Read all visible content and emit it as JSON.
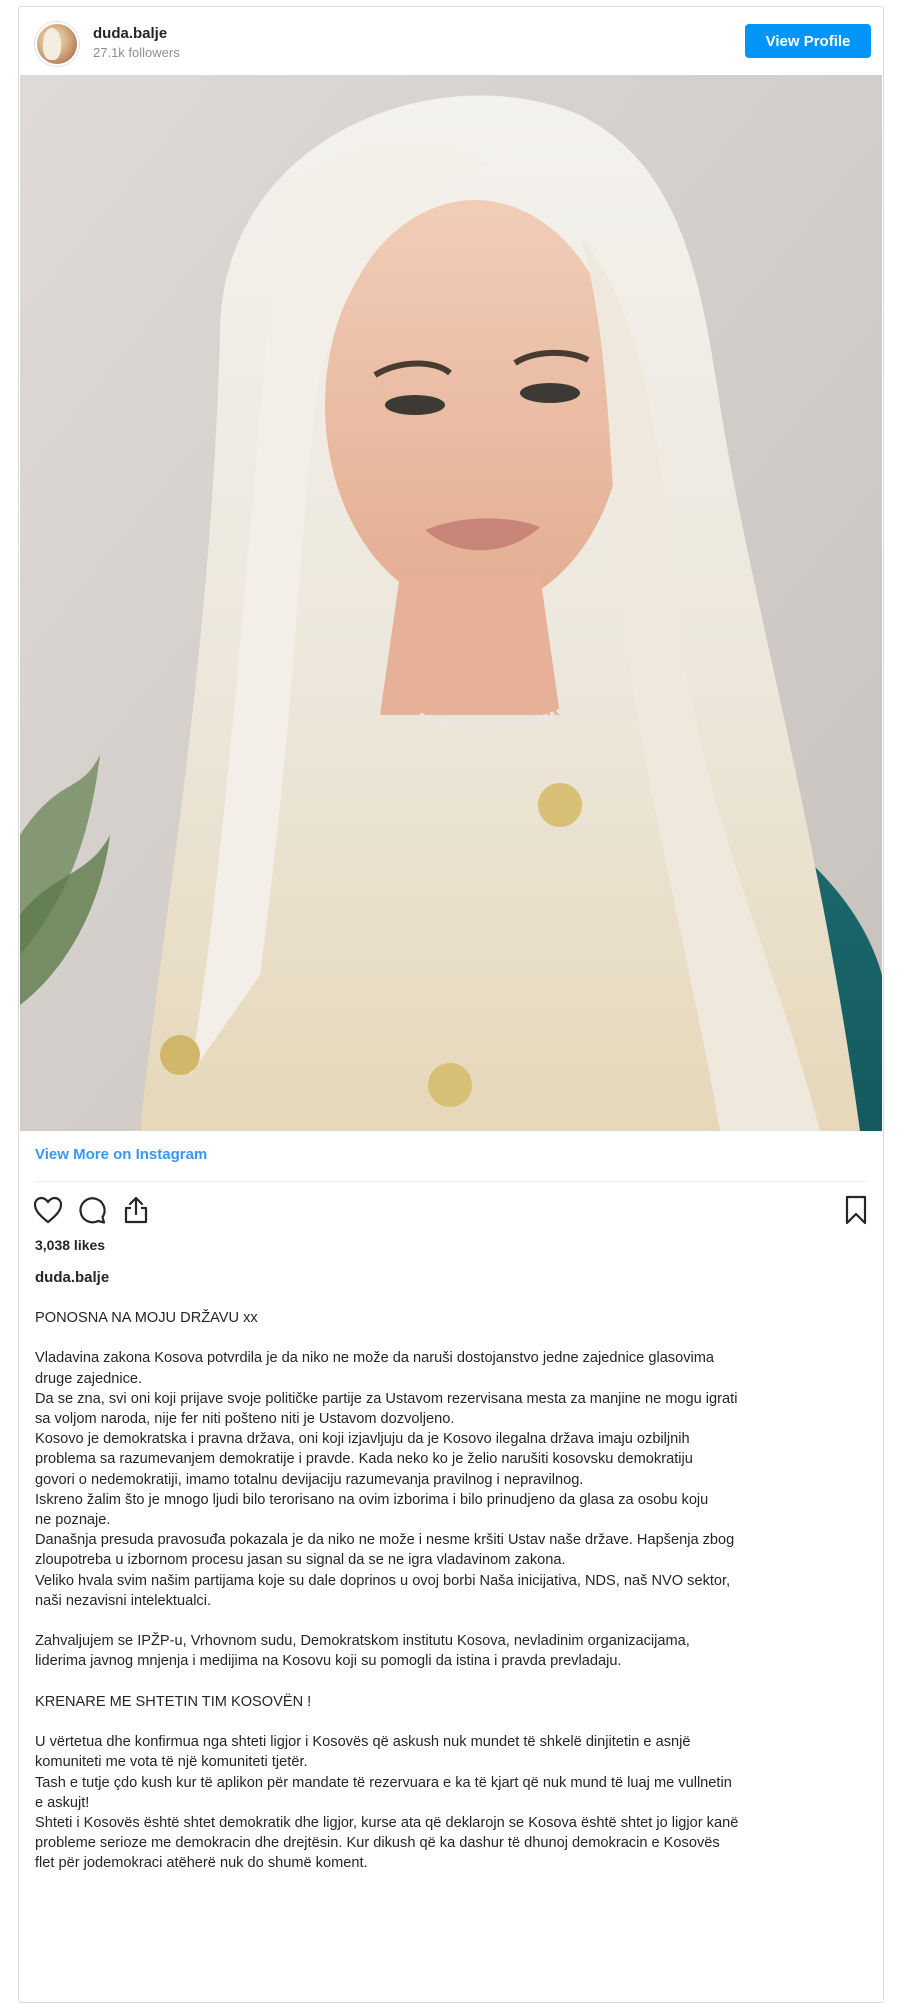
{
  "header": {
    "username": "duda.balje",
    "followers": "27.1k followers",
    "view_profile_label": "View Profile"
  },
  "post": {
    "view_more_label": "View More on Instagram",
    "likes": "3,038 likes",
    "caption_username": "duda.balje",
    "caption_lines": [
      "PONOSNA NA MOJU DRŽAVU xx",
      "",
      "Vladavina zakona Kosova potvrdila je da niko ne može da naruši dostojanstvo jedne zajednice glasovima",
      "druge zajednice.",
      "Da se zna, svi oni koji prijave svoje političke partije za Ustavom rezervisana mesta za manjine ne mogu igrati",
      "sa voljom naroda, nije fer niti pošteno niti je Ustavom dozvoljeno.",
      "Kosovo je demokratska i pravna država, oni koji izjavljuju da je Kosovo ilegalna država imaju ozbiljnih",
      "problema sa razumevanjem demokratije i pravde. Kada neko ko je želio narušiti kosovsku demokratiju",
      "govori o nedemokratiji, imamo totalnu devijaciju razumevanja pravilnog i nepravilnog.",
      "Iskreno žalim što je mnogo ljudi bilo terorisano na ovim izborima i bilo prinudjeno da glasa za osobu koju",
      "ne poznaje.",
      "Današnja presuda pravosuđa pokazala je da niko ne može i nesme kršiti Ustav naše države. Hapšenja zbog",
      "zloupotreba u izbornom procesu jasan su signal da se ne igra vladavinom zakona.",
      "Veliko hvala svim našim partijama koje su dale doprinos u ovoj borbi Naša inicijativa, NDS, naš NVO sektor,",
      "naši nezavisni intelektualci.",
      "",
      "Zahvaljujem se IPŽP-u, Vrhovnom sudu, Demokratskom institutu Kosova, nevladinim organizacijama,",
      "liderima javnog mnjenja i medijima na Kosovu koji su pomogli da istina i pravda prevladaju.",
      "",
      "KRENARE ME SHTETIN TIM KOSOVËN !",
      "",
      "U vërtetua dhe konfirmua nga shteti ligjor i Kosovës që askush nuk mundet të shkelë dinjitetin e asnjë",
      "komuniteti me vota të një komuniteti tjetër.",
      "Tash e tutje çdo kush kur të aplikon për mandate të rezervuara e ka të kjart që nuk mund të luaj me vullnetin",
      "e askujt!",
      "Shteti i Kosovës është shtet demokratik dhe ligjor, kurse ata që deklarojn se Kosova është shtet jo ligjor kanë",
      "probleme serioze me demokracin dhe drejtësin. Kur dikush që ka dashur të dhunoj demokracin e Kosovës",
      "flet për jodemokraci atëherë nuk do shumë koment."
    ]
  },
  "icons": {
    "like": "heart-icon",
    "comment": "comment-icon",
    "share": "share-icon",
    "save": "bookmark-icon"
  },
  "colors": {
    "accent": "#0095f6",
    "link": "#3897f0",
    "muted": "#8e8e8e",
    "border": "#dbdbdb"
  }
}
